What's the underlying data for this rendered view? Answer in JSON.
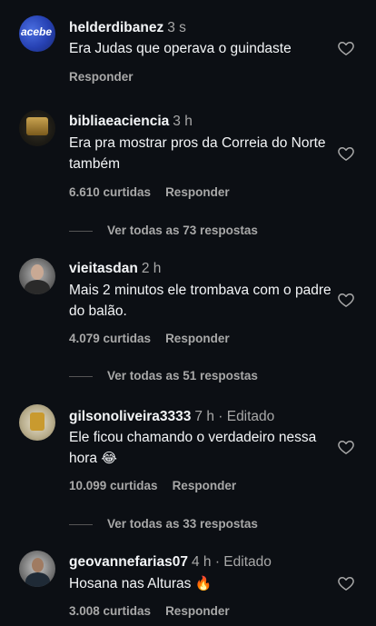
{
  "comments": [
    {
      "username": "helderdibanez",
      "time": "3 s",
      "text": "Era Judas que operava o guindaste",
      "likes": "",
      "reply_label": "Responder",
      "avatar_text": "acebe"
    },
    {
      "username": "bibliaeaciencia",
      "time": "3 h",
      "text": "Era pra mostrar pros da Correia do Norte também",
      "likes": "6.610 curtidas",
      "reply_label": "Responder",
      "view_replies": "Ver todas as 73 respostas"
    },
    {
      "username": "vieitasdan",
      "time": "2 h",
      "text": "Mais 2 minutos ele trombava com o padre do balão.",
      "likes": "4.079 curtidas",
      "reply_label": "Responder",
      "view_replies": "Ver todas as 51 respostas"
    },
    {
      "username": "gilsonoliveira3333",
      "time": "7 h · Editado",
      "text": "Ele ficou chamando o verdadeiro nessa hora",
      "emoji": "😂",
      "likes": "10.099 curtidas",
      "reply_label": "Responder",
      "view_replies": "Ver todas as 33 respostas"
    },
    {
      "username": "geovannefarias07",
      "time": "4 h · Editado",
      "text": "Hosana nas Alturas",
      "emoji": "🔥",
      "likes": "3.008 curtidas",
      "reply_label": "Responder"
    }
  ]
}
